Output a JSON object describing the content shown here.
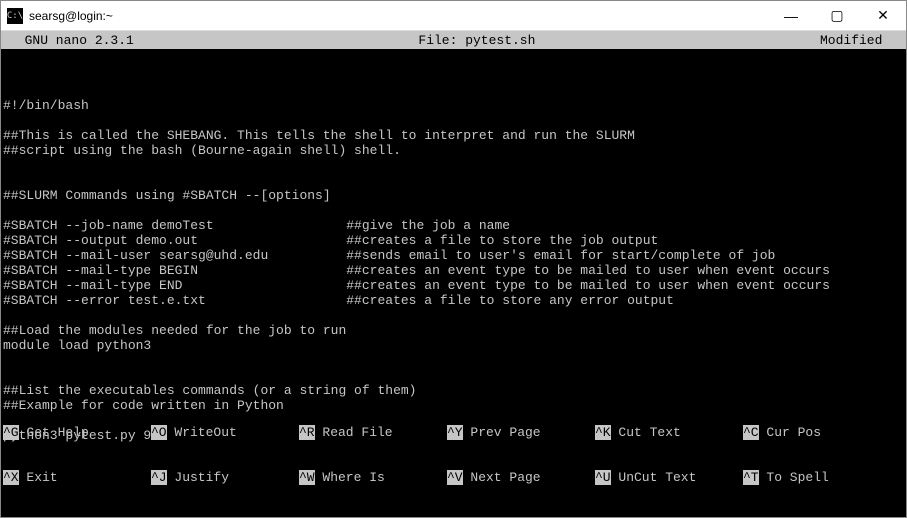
{
  "titlebar": {
    "icon_glyph": "C:\\",
    "title": "searsg@login:~"
  },
  "win_controls": {
    "minimize": "—",
    "maximize": "▢",
    "close": "✕"
  },
  "status": {
    "left": "  GNU nano 2.3.1",
    "center": "File: pytest.sh",
    "right": "Modified  "
  },
  "editor_lines": [
    "",
    "#!/bin/bash",
    "",
    "##This is called the SHEBANG. This tells the shell to interpret and run the SLURM",
    "##script using the bash (Bourne-again shell) shell.",
    "",
    "",
    "##SLURM Commands using #SBATCH --[options]",
    "",
    "#SBATCH --job-name demoTest                 ##give the job a name",
    "#SBATCH --output demo.out                   ##creates a file to store the job output",
    "#SBATCH --mail-user searsg@uhd.edu          ##sends email to user's email for start/complete of job",
    "#SBATCH --mail-type BEGIN                   ##creates an event type to be mailed to user when event occurs",
    "#SBATCH --mail-type END                     ##creates an event type to be mailed to user when event occurs",
    "#SBATCH --error test.e.txt                  ##creates a file to store any error output",
    "",
    "##Load the modules needed for the job to run",
    "module load python3",
    "",
    "",
    "##List the executables commands (or a string of them)",
    "##Example for code written in Python",
    "",
    "python3 pytest.py 90"
  ],
  "shortcuts": {
    "row1": [
      {
        "key": "^G",
        "label": "Get Help"
      },
      {
        "key": "^O",
        "label": "WriteOut"
      },
      {
        "key": "^R",
        "label": "Read File"
      },
      {
        "key": "^Y",
        "label": "Prev Page"
      },
      {
        "key": "^K",
        "label": "Cut Text"
      },
      {
        "key": "^C",
        "label": "Cur Pos"
      }
    ],
    "row2": [
      {
        "key": "^X",
        "label": "Exit"
      },
      {
        "key": "^J",
        "label": "Justify"
      },
      {
        "key": "^W",
        "label": "Where Is"
      },
      {
        "key": "^V",
        "label": "Next Page"
      },
      {
        "key": "^U",
        "label": "UnCut Text"
      },
      {
        "key": "^T",
        "label": "To Spell"
      }
    ]
  }
}
